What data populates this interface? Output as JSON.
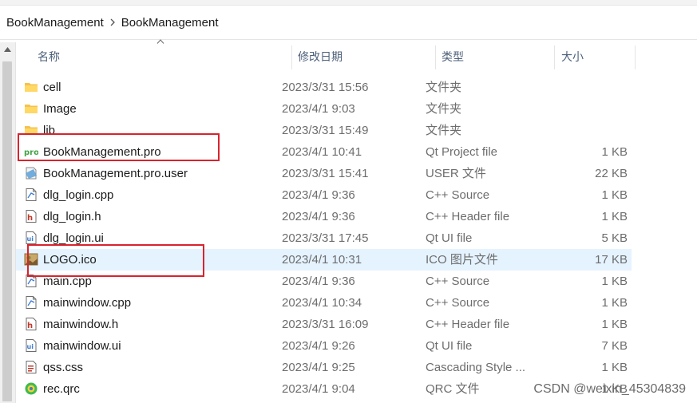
{
  "breadcrumb": [
    "BookManagement",
    "BookManagement"
  ],
  "columns": {
    "name": "名称",
    "date": "修改日期",
    "type": "类型",
    "size": "大小"
  },
  "files": [
    {
      "name": "cell",
      "date": "2023/3/31 15:56",
      "type": "文件夹",
      "size": "",
      "icon": "folder-icon"
    },
    {
      "name": "Image",
      "date": "2023/4/1 9:03",
      "type": "文件夹",
      "size": "",
      "icon": "folder-icon"
    },
    {
      "name": "lib",
      "date": "2023/3/31 15:49",
      "type": "文件夹",
      "size": "",
      "icon": "folder-icon"
    },
    {
      "name": "BookManagement.pro",
      "date": "2023/4/1 10:41",
      "type": "Qt Project file",
      "size": "1 KB",
      "icon": "qt-project-icon"
    },
    {
      "name": "BookManagement.pro.user",
      "date": "2023/3/31 15:41",
      "type": "USER 文件",
      "size": "22 KB",
      "icon": "user-file-icon"
    },
    {
      "name": "dlg_login.cpp",
      "date": "2023/4/1 9:36",
      "type": "C++ Source",
      "size": "1 KB",
      "icon": "cpp-file-icon"
    },
    {
      "name": "dlg_login.h",
      "date": "2023/4/1 9:36",
      "type": "C++ Header file",
      "size": "1 KB",
      "icon": "header-file-icon"
    },
    {
      "name": "dlg_login.ui",
      "date": "2023/3/31 17:45",
      "type": "Qt UI file",
      "size": "5 KB",
      "icon": "ui-file-icon"
    },
    {
      "name": "LOGO.ico",
      "date": "2023/4/1 10:31",
      "type": "ICO 图片文件",
      "size": "17 KB",
      "icon": "ico-image-icon"
    },
    {
      "name": "main.cpp",
      "date": "2023/4/1 9:36",
      "type": "C++ Source",
      "size": "1 KB",
      "icon": "cpp-file-icon"
    },
    {
      "name": "mainwindow.cpp",
      "date": "2023/4/1 10:34",
      "type": "C++ Source",
      "size": "1 KB",
      "icon": "cpp-file-icon"
    },
    {
      "name": "mainwindow.h",
      "date": "2023/3/31 16:09",
      "type": "C++ Header file",
      "size": "1 KB",
      "icon": "header-file-icon"
    },
    {
      "name": "mainwindow.ui",
      "date": "2023/4/1 9:26",
      "type": "Qt UI file",
      "size": "7 KB",
      "icon": "ui-file-icon"
    },
    {
      "name": "qss.css",
      "date": "2023/4/1 9:25",
      "type": "Cascading Style ...",
      "size": "1 KB",
      "icon": "css-file-icon"
    },
    {
      "name": "rec.qrc",
      "date": "2023/4/1 9:04",
      "type": "QRC 文件",
      "size": "1 KB",
      "icon": "qrc-file-icon"
    }
  ],
  "watermark": "CSDN @weixin_45304839",
  "colors": {
    "selection": "#e5f3ff",
    "highlight_box": "#d9232d",
    "header_text": "#4c607a",
    "secondary_text": "#6d6d6d"
  }
}
